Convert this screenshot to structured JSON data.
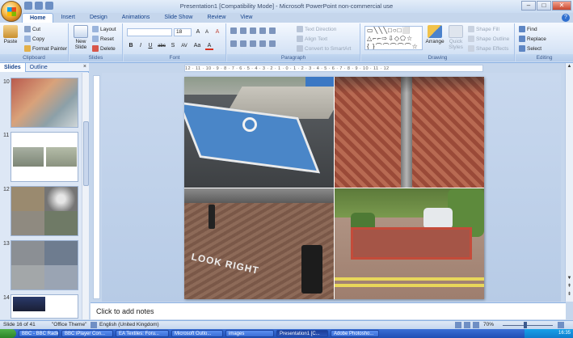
{
  "window": {
    "title": "Presentation1 [Compatibility Mode] - Microsoft PowerPoint non-commercial use",
    "controls": {
      "minimize": "–",
      "maximize": "□",
      "close": "✕"
    }
  },
  "ribbon_tabs": [
    "Home",
    "Insert",
    "Design",
    "Animations",
    "Slide Show",
    "Review",
    "View"
  ],
  "active_tab": "Home",
  "ribbon": {
    "clipboard": {
      "label": "Clipboard",
      "paste": "Paste",
      "cut": "Cut",
      "copy": "Copy",
      "format_painter": "Format Painter"
    },
    "slides": {
      "label": "Slides",
      "new_slide": "New Slide",
      "layout": "Layout",
      "reset": "Reset",
      "delete": "Delete"
    },
    "font": {
      "label": "Font",
      "size": "18",
      "bold": "B",
      "italic": "I",
      "underline": "U",
      "strike": "abc",
      "shadow": "S",
      "spacing": "AV",
      "case": "Aa",
      "color": "A",
      "grow": "A",
      "shrink": "A",
      "clear": "A"
    },
    "paragraph": {
      "label": "Paragraph",
      "text_direction": "Text Direction",
      "align_text": "Align Text",
      "convert_smartart": "Convert to SmartArt"
    },
    "drawing": {
      "label": "Drawing",
      "arrange": "Arrange",
      "quick_styles": "Quick Styles",
      "shape_fill": "Shape Fill",
      "shape_outline": "Shape Outline",
      "shape_effects": "Shape Effects"
    },
    "editing": {
      "label": "Editing",
      "find": "Find",
      "replace": "Replace",
      "select": "Select"
    }
  },
  "left_pane": {
    "tabs": [
      "Slides",
      "Outline"
    ],
    "active_tab": "Slides",
    "close": "×",
    "thumbnails": [
      {
        "number": "10"
      },
      {
        "number": "11"
      },
      {
        "number": "12"
      },
      {
        "number": "13"
      },
      {
        "number": "14"
      }
    ]
  },
  "ruler_text": "12 · 11 · 10 · 9 · 8 · 7 · 6 · 5 · 4 · 3 · 2 · 1 · 0 · 1 · 2 · 3 · 4 · 5 · 6 · 7 · 8 · 9 · 10 · 11 · 12",
  "slide_photos": [
    {
      "name": "disabled-parking-bay",
      "caption": ""
    },
    {
      "name": "brick-drainage-channel",
      "caption": ""
    },
    {
      "name": "look-right-crossing",
      "caption": "LOOK RIGHT"
    },
    {
      "name": "red-brick-driveway",
      "caption": ""
    }
  ],
  "notes": {
    "placeholder": "Click to add notes"
  },
  "status_bar": {
    "slide_counter": "Slide 16 of 41",
    "theme": "\"Office Theme\"",
    "language": "English (United Kingdom)",
    "zoom": "70%"
  },
  "taskbar": {
    "items": [
      "BBC - BBC Radio...",
      "BBC iPlayer Con...",
      "EA Textiles: Foru...",
      "Microsoft Outlo...",
      "images",
      "Presentation1 [C...",
      "Adobe Photosho..."
    ],
    "active_item": "Presentation1 [C...",
    "clock": "16:35"
  }
}
